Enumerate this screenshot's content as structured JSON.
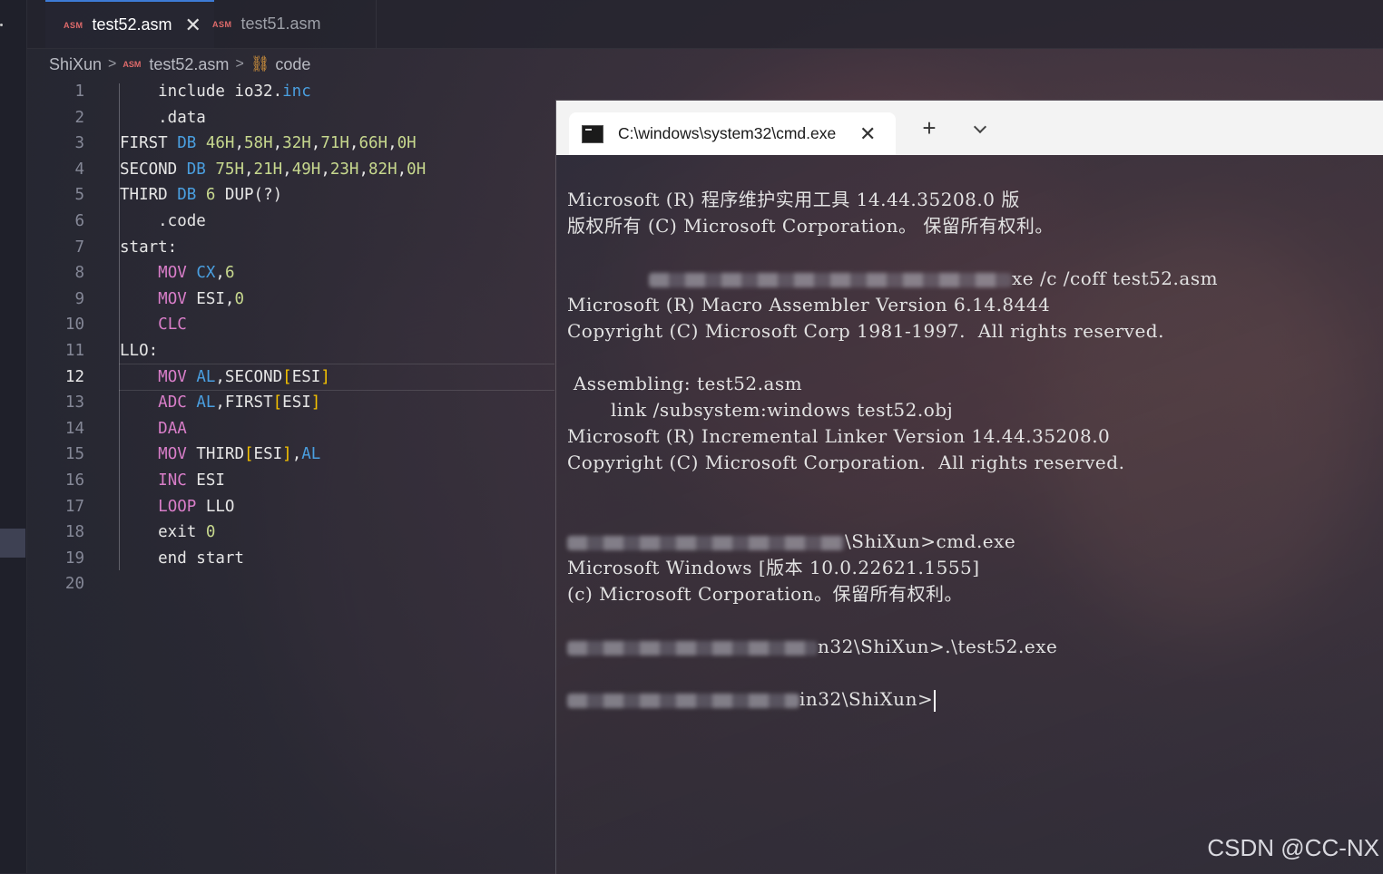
{
  "editor": {
    "tabs": [
      {
        "badge": "ASM",
        "label": "test52.asm",
        "close": "✕",
        "active": true
      },
      {
        "badge": "ASM",
        "label": "test51.asm",
        "active": false
      }
    ],
    "breadcrumb": {
      "folder": "ShiXun",
      "file_badge": "ASM",
      "file": "test52.asm",
      "symbol": "code",
      "separator": ">"
    },
    "current_line": 12,
    "code_lines": [
      "1",
      "2",
      "3",
      "4",
      "5",
      "6",
      "7",
      "8",
      "9",
      "10",
      "11",
      "12",
      "13",
      "14",
      "15",
      "16",
      "17",
      "18",
      "19",
      "20"
    ]
  },
  "terminal": {
    "tab_title": "C:\\windows\\system32\\cmd.exe",
    "tab_close": "✕",
    "new_tab": "+",
    "lines": {
      "l1": "Microsoft (R) 程序维护实用工具 14.44.35208.0 版",
      "l2": "版权所有 (C) Microsoft Corporation。 保留所有权利。",
      "l3_suffix": "xe /c /coff test52.asm",
      "l4": "Microsoft (R) Macro Assembler Version 6.14.8444",
      "l5": "Copyright (C) Microsoft Corp 1981-1997.  All rights reserved.",
      "l6": " Assembling: test52.asm",
      "l7": "       link /subsystem:windows test52.obj",
      "l8": "Microsoft (R) Incremental Linker Version 14.44.35208.0",
      "l9": "Copyright (C) Microsoft Corporation.  All rights reserved.",
      "l10_suffix": "\\ShiXun>cmd.exe",
      "l11": "Microsoft Windows [版本 10.0.22621.1555]",
      "l12": "(c) Microsoft Corporation。保留所有权利。",
      "l13_suffix": "n32\\ShiXun>.\\test52.exe",
      "l14_suffix": "in32\\ShiXun>"
    }
  },
  "watermark": "CSDN @CC-NX",
  "colors": {
    "keyword": "#d97ec9",
    "directive": "#4a9fe0",
    "number": "#c7d88e",
    "bracket": "#f5c200",
    "tab_accent": "#3d7bd6",
    "asm_badge": "#e06b6b"
  }
}
